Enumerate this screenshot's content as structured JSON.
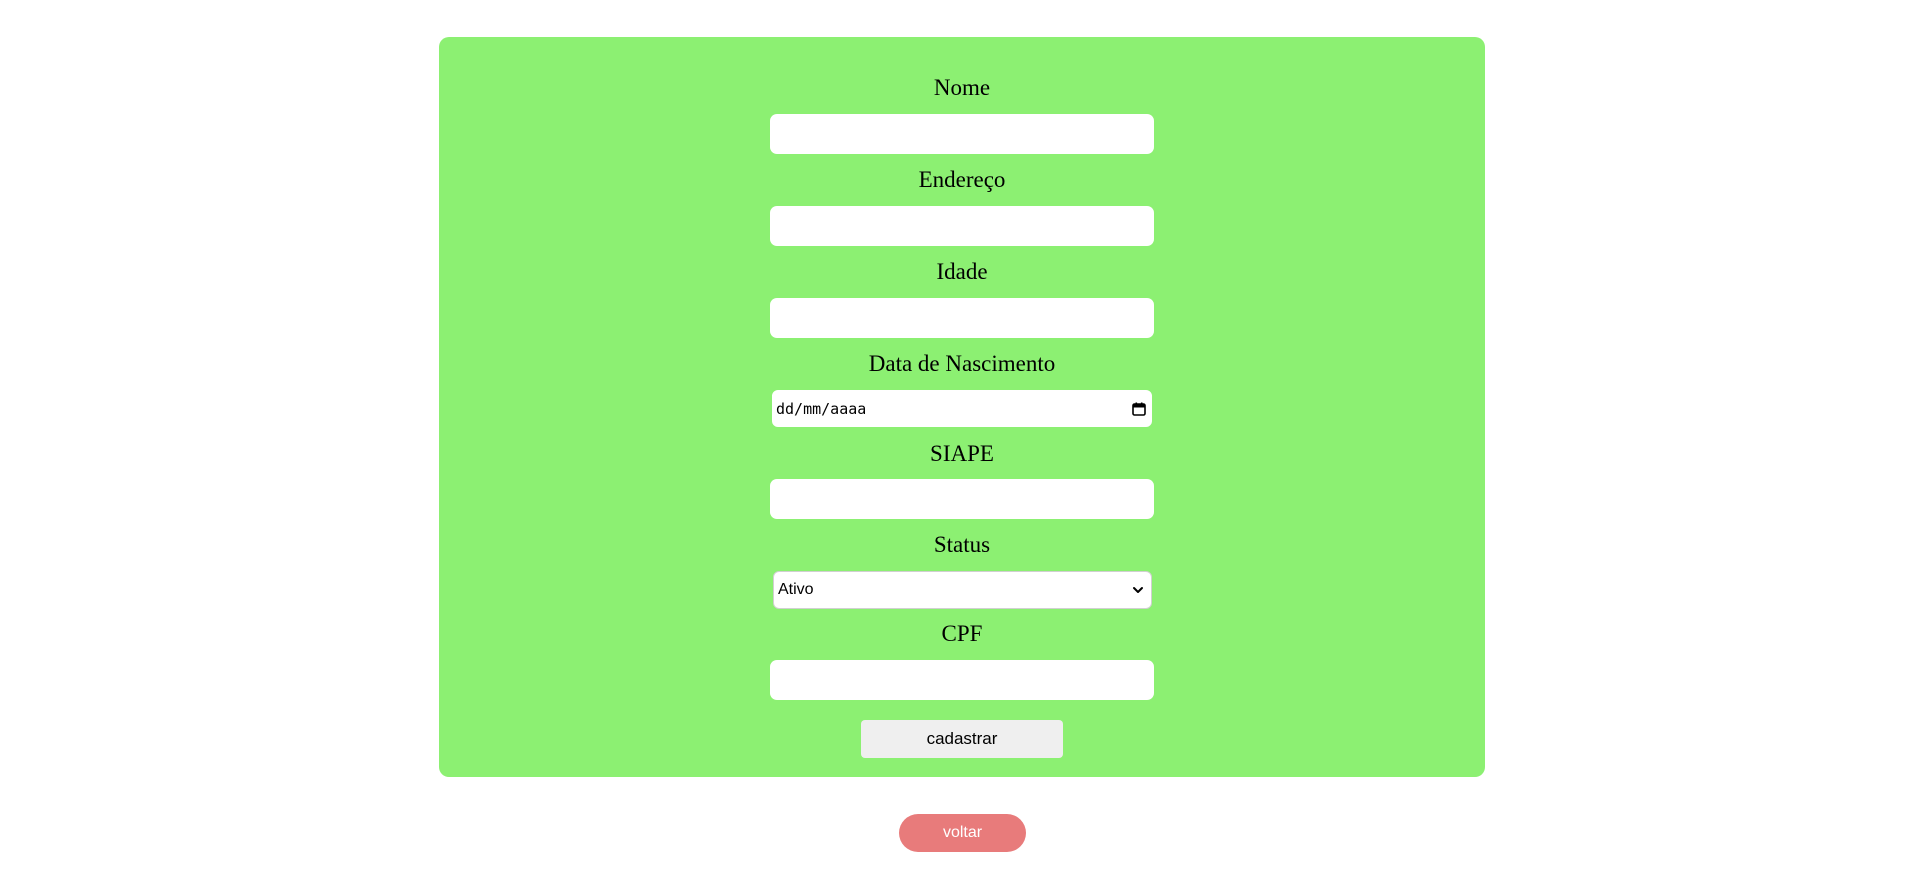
{
  "form": {
    "nome": {
      "label": "Nome",
      "value": ""
    },
    "endereco": {
      "label": "Endereço",
      "value": ""
    },
    "idade": {
      "label": "Idade",
      "value": ""
    },
    "data_nascimento": {
      "label": "Data de Nascimento",
      "placeholder": "dd/mm/aaaa"
    },
    "siape": {
      "label": "SIAPE",
      "value": ""
    },
    "status": {
      "label": "Status",
      "selected": "Ativo"
    },
    "cpf": {
      "label": "CPF",
      "value": ""
    },
    "submit_label": "cadastrar"
  },
  "back_label": "voltar",
  "icons": {
    "date": "calendar-icon",
    "select": "chevron-down-icon"
  },
  "colors": {
    "card_background": "#8cf072",
    "back_button": "#e87b7b",
    "submit_button": "#efefef"
  }
}
